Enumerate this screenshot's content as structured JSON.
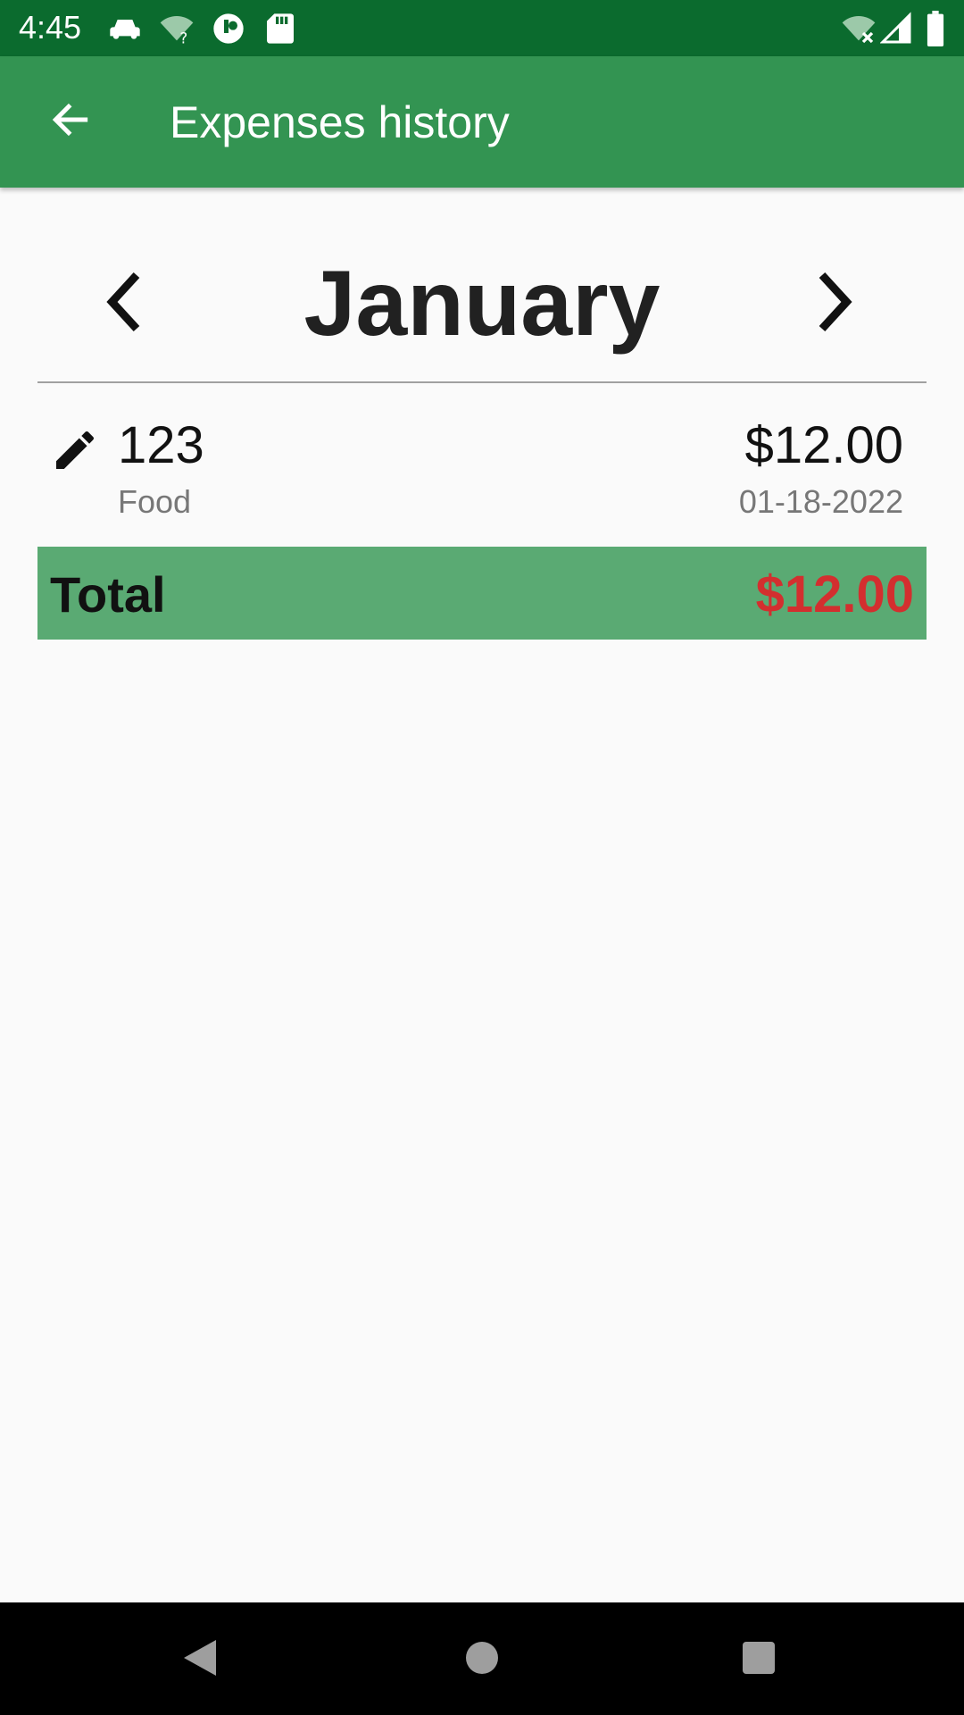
{
  "status_bar": {
    "time": "4:45",
    "icons": [
      "car-icon",
      "wifi-question-icon",
      "circle-app-icon",
      "sd-card-icon",
      "wifi-x-icon",
      "signal-icon",
      "battery-icon"
    ]
  },
  "app_bar": {
    "title": "Expenses history",
    "back_icon": "arrow-back-icon",
    "background": "#339452"
  },
  "month_nav": {
    "month": "January",
    "prev_icon": "chevron-left-icon",
    "next_icon": "chevron-right-icon"
  },
  "expenses": [
    {
      "name": "123",
      "category": "Food",
      "amount": "$12.00",
      "date": "01-18-2022",
      "edit_icon": "pencil-icon"
    }
  ],
  "total": {
    "label": "Total",
    "value": "$12.00",
    "value_color": "#d32f2f",
    "background": "#5aaa73"
  },
  "nav_bar": {
    "icons": [
      "back-triangle-icon",
      "home-circle-icon",
      "recents-square-icon"
    ]
  },
  "colors": {
    "status_bar": "#0b6b2e",
    "accent": "#339452"
  }
}
